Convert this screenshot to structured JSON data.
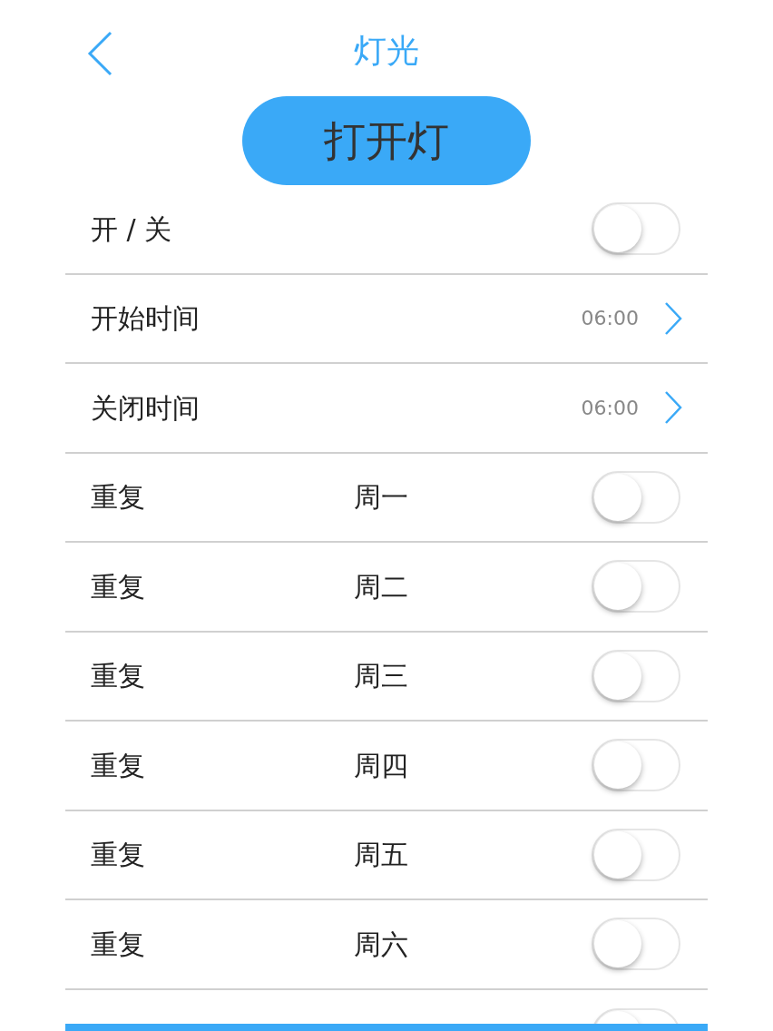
{
  "header": {
    "title": "灯光"
  },
  "main_button": {
    "label": "打开灯"
  },
  "rows": [
    {
      "kind": "toggle",
      "label": "开 / 关",
      "on": false
    },
    {
      "kind": "time",
      "label": "开始时间",
      "value": "06:00"
    },
    {
      "kind": "time",
      "label": "关闭时间",
      "value": "06:00"
    },
    {
      "kind": "day",
      "label": "重复",
      "day": "周一",
      "on": false
    },
    {
      "kind": "day",
      "label": "重复",
      "day": "周二",
      "on": false
    },
    {
      "kind": "day",
      "label": "重复",
      "day": "周三",
      "on": false
    },
    {
      "kind": "day",
      "label": "重复",
      "day": "周四",
      "on": false
    },
    {
      "kind": "day",
      "label": "重复",
      "day": "周五",
      "on": false
    },
    {
      "kind": "day",
      "label": "重复",
      "day": "周六",
      "on": false
    },
    {
      "kind": "partial",
      "on": false
    }
  ]
}
